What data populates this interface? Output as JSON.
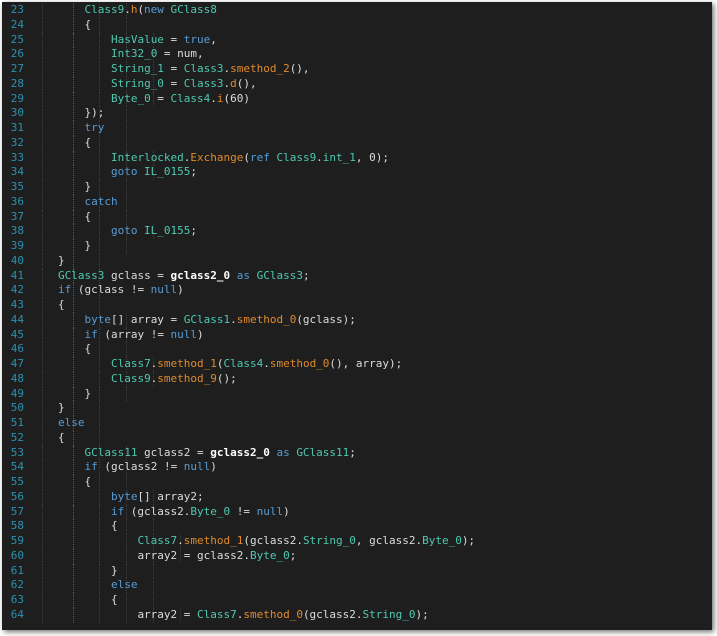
{
  "colors": {
    "background": "#1e1e1e",
    "line_number": "#2b91af",
    "keyword": "#569cd6",
    "type": "#4ec9b0",
    "method": "#e08a2c",
    "identifier": "#dcdcdc",
    "bold_identifier": "#ffffff"
  },
  "lines": [
    {
      "n": "23",
      "lvl": 4,
      "t": [
        [
          "Class9",
          "ty"
        ],
        [
          ".",
          "p"
        ],
        [
          "h",
          "me"
        ],
        [
          "(",
          "p"
        ],
        [
          "new",
          "kw"
        ],
        [
          " ",
          "p"
        ],
        [
          "GClass8",
          "ty"
        ]
      ]
    },
    {
      "n": "24",
      "lvl": 4,
      "t": [
        [
          "{",
          "p"
        ]
      ]
    },
    {
      "n": "25",
      "lvl": 5,
      "t": [
        [
          "HasValue",
          "ty"
        ],
        [
          " = ",
          "p"
        ],
        [
          "true",
          "kw"
        ],
        [
          ",",
          "p"
        ]
      ]
    },
    {
      "n": "26",
      "lvl": 5,
      "t": [
        [
          "Int32_0",
          "ty"
        ],
        [
          " = num,",
          "p"
        ]
      ]
    },
    {
      "n": "27",
      "lvl": 5,
      "t": [
        [
          "String_1",
          "ty"
        ],
        [
          " = ",
          "p"
        ],
        [
          "Class3",
          "ty"
        ],
        [
          ".",
          "p"
        ],
        [
          "smethod_2",
          "me"
        ],
        [
          "(),",
          "p"
        ]
      ]
    },
    {
      "n": "28",
      "lvl": 5,
      "t": [
        [
          "String_0",
          "ty"
        ],
        [
          " = ",
          "p"
        ],
        [
          "Class3",
          "ty"
        ],
        [
          ".",
          "p"
        ],
        [
          "d",
          "me"
        ],
        [
          "(),",
          "p"
        ]
      ]
    },
    {
      "n": "29",
      "lvl": 5,
      "t": [
        [
          "Byte_0",
          "ty"
        ],
        [
          " = ",
          "p"
        ],
        [
          "Class4",
          "ty"
        ],
        [
          ".",
          "p"
        ],
        [
          "i",
          "me"
        ],
        [
          "(60)",
          "p"
        ]
      ]
    },
    {
      "n": "30",
      "lvl": 4,
      "t": [
        [
          "});",
          "p"
        ]
      ]
    },
    {
      "n": "31",
      "lvl": 4,
      "t": [
        [
          "try",
          "kw"
        ]
      ]
    },
    {
      "n": "32",
      "lvl": 4,
      "t": [
        [
          "{",
          "p"
        ]
      ]
    },
    {
      "n": "33",
      "lvl": 5,
      "t": [
        [
          "Interlocked",
          "ty"
        ],
        [
          ".",
          "p"
        ],
        [
          "Exchange",
          "me"
        ],
        [
          "(",
          "p"
        ],
        [
          "ref",
          "kw"
        ],
        [
          " ",
          "p"
        ],
        [
          "Class9",
          "ty"
        ],
        [
          ".",
          "p"
        ],
        [
          "int_1",
          "ty"
        ],
        [
          ", 0);",
          "p"
        ]
      ]
    },
    {
      "n": "34",
      "lvl": 5,
      "t": [
        [
          "goto",
          "kw"
        ],
        [
          " ",
          "p"
        ],
        [
          "IL_0155",
          "ty"
        ],
        [
          ";",
          "p"
        ]
      ]
    },
    {
      "n": "35",
      "lvl": 4,
      "t": [
        [
          "}",
          "p"
        ]
      ]
    },
    {
      "n": "36",
      "lvl": 4,
      "t": [
        [
          "catch",
          "kw"
        ]
      ]
    },
    {
      "n": "37",
      "lvl": 4,
      "t": [
        [
          "{",
          "p"
        ]
      ]
    },
    {
      "n": "38",
      "lvl": 5,
      "t": [
        [
          "goto",
          "kw"
        ],
        [
          " ",
          "p"
        ],
        [
          "IL_0155",
          "ty"
        ],
        [
          ";",
          "p"
        ]
      ]
    },
    {
      "n": "39",
      "lvl": 4,
      "t": [
        [
          "}",
          "p"
        ]
      ]
    },
    {
      "n": "40",
      "lvl": 3,
      "t": [
        [
          "}",
          "p"
        ]
      ]
    },
    {
      "n": "41",
      "lvl": 3,
      "t": [
        [
          "GClass3",
          "ty"
        ],
        [
          " gclass = ",
          "p"
        ],
        [
          "gclass2_0",
          "b"
        ],
        [
          " ",
          "p"
        ],
        [
          "as",
          "kw"
        ],
        [
          " ",
          "p"
        ],
        [
          "GClass3",
          "ty"
        ],
        [
          ";",
          "p"
        ]
      ]
    },
    {
      "n": "42",
      "lvl": 3,
      "t": [
        [
          "if",
          "kw"
        ],
        [
          " (gclass != ",
          "p"
        ],
        [
          "null",
          "kw"
        ],
        [
          ")",
          "p"
        ]
      ]
    },
    {
      "n": "43",
      "lvl": 3,
      "t": [
        [
          "{",
          "p"
        ]
      ]
    },
    {
      "n": "44",
      "lvl": 4,
      "t": [
        [
          "byte",
          "kw"
        ],
        [
          "[] array = ",
          "p"
        ],
        [
          "GClass1",
          "ty"
        ],
        [
          ".",
          "p"
        ],
        [
          "smethod_0",
          "me"
        ],
        [
          "(gclass);",
          "p"
        ]
      ]
    },
    {
      "n": "45",
      "lvl": 4,
      "t": [
        [
          "if",
          "kw"
        ],
        [
          " (array != ",
          "p"
        ],
        [
          "null",
          "kw"
        ],
        [
          ")",
          "p"
        ]
      ]
    },
    {
      "n": "46",
      "lvl": 4,
      "t": [
        [
          "{",
          "p"
        ]
      ]
    },
    {
      "n": "47",
      "lvl": 5,
      "t": [
        [
          "Class7",
          "ty"
        ],
        [
          ".",
          "p"
        ],
        [
          "smethod_1",
          "me"
        ],
        [
          "(",
          "p"
        ],
        [
          "Class4",
          "ty"
        ],
        [
          ".",
          "p"
        ],
        [
          "smethod_0",
          "me"
        ],
        [
          "(), array);",
          "p"
        ]
      ]
    },
    {
      "n": "48",
      "lvl": 5,
      "t": [
        [
          "Class9",
          "ty"
        ],
        [
          ".",
          "p"
        ],
        [
          "smethod_9",
          "me"
        ],
        [
          "();",
          "p"
        ]
      ]
    },
    {
      "n": "49",
      "lvl": 4,
      "t": [
        [
          "}",
          "p"
        ]
      ]
    },
    {
      "n": "50",
      "lvl": 3,
      "t": [
        [
          "}",
          "p"
        ]
      ]
    },
    {
      "n": "51",
      "lvl": 3,
      "t": [
        [
          "else",
          "kw"
        ]
      ]
    },
    {
      "n": "52",
      "lvl": 3,
      "t": [
        [
          "{",
          "p"
        ]
      ]
    },
    {
      "n": "53",
      "lvl": 4,
      "t": [
        [
          "GClass11",
          "ty"
        ],
        [
          " gclass2 = ",
          "p"
        ],
        [
          "gclass2_0",
          "b"
        ],
        [
          " ",
          "p"
        ],
        [
          "as",
          "kw"
        ],
        [
          " ",
          "p"
        ],
        [
          "GClass11",
          "ty"
        ],
        [
          ";",
          "p"
        ]
      ]
    },
    {
      "n": "54",
      "lvl": 4,
      "t": [
        [
          "if",
          "kw"
        ],
        [
          " (gclass2 != ",
          "p"
        ],
        [
          "null",
          "kw"
        ],
        [
          ")",
          "p"
        ]
      ]
    },
    {
      "n": "55",
      "lvl": 4,
      "t": [
        [
          "{",
          "p"
        ]
      ]
    },
    {
      "n": "56",
      "lvl": 5,
      "t": [
        [
          "byte",
          "kw"
        ],
        [
          "[] array2;",
          "p"
        ]
      ]
    },
    {
      "n": "57",
      "lvl": 5,
      "t": [
        [
          "if",
          "kw"
        ],
        [
          " (gclass2.",
          "p"
        ],
        [
          "Byte_0",
          "ty"
        ],
        [
          " != ",
          "p"
        ],
        [
          "null",
          "kw"
        ],
        [
          ")",
          "p"
        ]
      ]
    },
    {
      "n": "58",
      "lvl": 5,
      "t": [
        [
          "{",
          "p"
        ]
      ]
    },
    {
      "n": "59",
      "lvl": 6,
      "t": [
        [
          "Class7",
          "ty"
        ],
        [
          ".",
          "p"
        ],
        [
          "smethod_1",
          "me"
        ],
        [
          "(gclass2.",
          "p"
        ],
        [
          "String_0",
          "ty"
        ],
        [
          ", gclass2.",
          "p"
        ],
        [
          "Byte_0",
          "ty"
        ],
        [
          ");",
          "p"
        ]
      ]
    },
    {
      "n": "60",
      "lvl": 6,
      "t": [
        [
          "array2 = gclass2.",
          "p"
        ],
        [
          "Byte_0",
          "ty"
        ],
        [
          ";",
          "p"
        ]
      ]
    },
    {
      "n": "61",
      "lvl": 5,
      "t": [
        [
          "}",
          "p"
        ]
      ]
    },
    {
      "n": "62",
      "lvl": 5,
      "t": [
        [
          "else",
          "kw"
        ]
      ]
    },
    {
      "n": "63",
      "lvl": 5,
      "t": [
        [
          "{",
          "p"
        ]
      ]
    },
    {
      "n": "64",
      "lvl": 6,
      "t": [
        [
          "array2 = ",
          "p"
        ],
        [
          "Class7",
          "ty"
        ],
        [
          ".",
          "p"
        ],
        [
          "smethod_0",
          "me"
        ],
        [
          "(gclass2.",
          "p"
        ],
        [
          "String_0",
          "ty"
        ],
        [
          ");",
          "p"
        ]
      ]
    }
  ]
}
